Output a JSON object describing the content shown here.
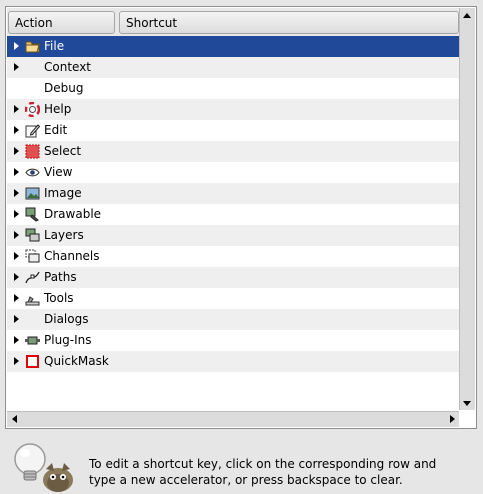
{
  "columns": {
    "action": "Action",
    "shortcut": "Shortcut"
  },
  "rows": [
    {
      "label": "File",
      "icon": "folder-icon",
      "expander": true,
      "selected": true
    },
    {
      "label": "Context",
      "icon": null,
      "expander": true,
      "selected": false
    },
    {
      "label": "Debug",
      "icon": null,
      "expander": false,
      "selected": false
    },
    {
      "label": "Help",
      "icon": "help-lifebuoy-icon",
      "expander": true,
      "selected": false
    },
    {
      "label": "Edit",
      "icon": "edit-pencil-icon",
      "expander": true,
      "selected": false
    },
    {
      "label": "Select",
      "icon": "selection-icon",
      "expander": true,
      "selected": false
    },
    {
      "label": "View",
      "icon": "eye-icon",
      "expander": true,
      "selected": false
    },
    {
      "label": "Image",
      "icon": "image-icon",
      "expander": true,
      "selected": false
    },
    {
      "label": "Drawable",
      "icon": "drawable-icon",
      "expander": true,
      "selected": false
    },
    {
      "label": "Layers",
      "icon": "layers-icon",
      "expander": true,
      "selected": false
    },
    {
      "label": "Channels",
      "icon": "channels-icon",
      "expander": true,
      "selected": false
    },
    {
      "label": "Paths",
      "icon": "paths-icon",
      "expander": true,
      "selected": false
    },
    {
      "label": "Tools",
      "icon": "tools-icon",
      "expander": true,
      "selected": false
    },
    {
      "label": "Dialogs",
      "icon": null,
      "expander": true,
      "selected": false
    },
    {
      "label": "Plug-Ins",
      "icon": "plugin-icon",
      "expander": true,
      "selected": false
    },
    {
      "label": "QuickMask",
      "icon": "quickmask-icon",
      "expander": true,
      "selected": false
    }
  ],
  "hint": {
    "line1": "To edit a shortcut key, click on the corresponding row and",
    "line2": "type a new accelerator, or press backspace to clear."
  },
  "colors": {
    "selection": "#204a99",
    "quickmask": "#e00000",
    "select_icon": "#d81b1b"
  }
}
